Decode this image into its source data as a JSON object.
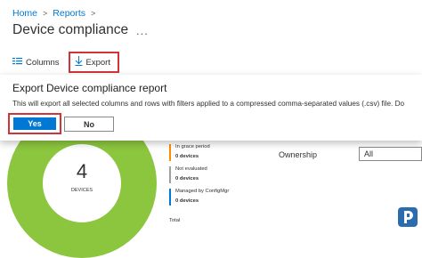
{
  "breadcrumb": {
    "home": "Home",
    "reports": "Reports",
    "separator": ">"
  },
  "page": {
    "title": "Device compliance",
    "more": "..."
  },
  "toolbar": {
    "columns_label": "Columns",
    "export_label": "Export"
  },
  "dialog": {
    "title": "Export Device compliance report",
    "message": "This will export all selected columns and rows with filters applied to a compressed comma-separated values (.csv) file. Do",
    "yes_label": "Yes",
    "no_label": "No"
  },
  "chart": {
    "total": "4",
    "unit": "DEVICES",
    "color": "#8cc63f"
  },
  "legend": {
    "items": [
      {
        "label": "In grace period",
        "sub": "0 devices",
        "color": "#ff8c00"
      },
      {
        "label": "Not evaluated",
        "sub": "0 devices",
        "color": "#a0a0a0"
      },
      {
        "label": "Managed by ConfigMgr",
        "sub": "0 devices",
        "color": "#0078d4"
      }
    ],
    "total_label": "Total"
  },
  "filters": {
    "ownership_label": "Ownership",
    "ownership_value": "All"
  }
}
